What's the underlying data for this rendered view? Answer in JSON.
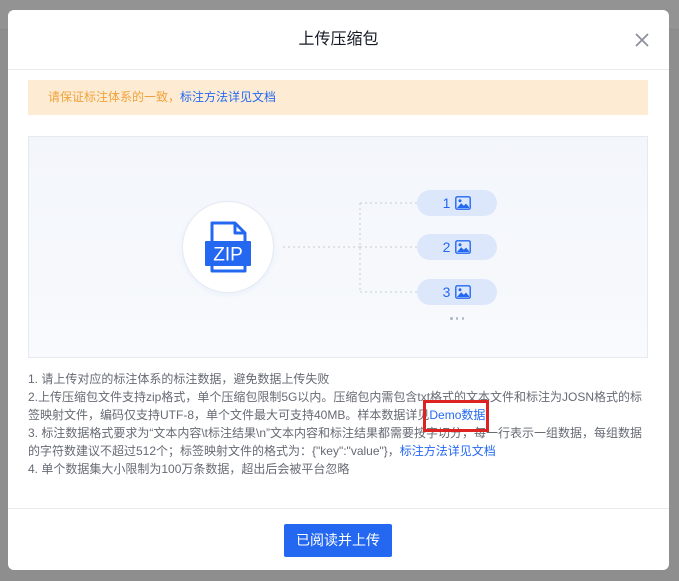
{
  "colors": {
    "accent": "#2468f2",
    "warning_text": "#f0a23a",
    "warning_bg": "#fdecd3",
    "annotation": "#dd2222"
  },
  "dialog": {
    "title": "上传压缩包",
    "close_icon": "close-icon"
  },
  "notice": {
    "text": "请保证标注体系的一致，",
    "link": "标注方法详见文档"
  },
  "illustration": {
    "file_icon": "zip-file-icon",
    "file_label": "ZIP",
    "items": [
      {
        "index": "1",
        "icon": "image-icon"
      },
      {
        "index": "2",
        "icon": "image-icon"
      },
      {
        "index": "3",
        "icon": "image-icon"
      }
    ]
  },
  "instructions": {
    "item1": "1. 请上传对应的标注体系的标注数据，避免数据上传失败",
    "item2_text": "2.上传压缩包文件支持zip格式，单个压缩包限制5G以内。压缩包内需包含txt格式的文本文件和标注为JOSN格式的标签映射文件，编码仅支持UTF-8，单个文件最大可支持40MB。样本数据详见",
    "item2_link": "Demo数据",
    "item3_text": "3. 标注数据格式要求为“文本内容\\t标注结果\\n”文本内容和标注结果都需要按字切分，每一行表示一组数据，每组数据的字符数建议不超过512个；标签映射文件的格式为：{\"key\":\"value\"}，",
    "item3_link": "标注方法详见文档",
    "item4": "4. 单个数据集大小限制为100万条数据，超出后会被平台忽略"
  },
  "footer": {
    "confirm_label": "已阅读并上传"
  }
}
